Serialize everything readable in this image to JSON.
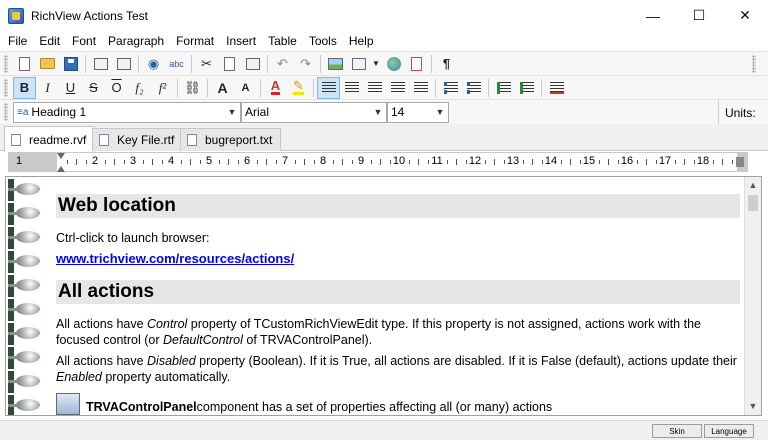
{
  "window": {
    "title": "RichView Actions Test",
    "minimize": "—",
    "maximize": "☐",
    "close": "✕"
  },
  "menu": [
    "File",
    "Edit",
    "Font",
    "Paragraph",
    "Format",
    "Insert",
    "Table",
    "Tools",
    "Help"
  ],
  "format_bar": {
    "style_value": "Heading 1",
    "font_value": "Arial",
    "size_value": "14",
    "units_label": "Units:"
  },
  "toolbar_glyphs": {
    "bold": "B",
    "italic": "I",
    "underline": "U",
    "strike": "S",
    "overline": "O",
    "subscript": "f₂",
    "superscript": "f²",
    "link": "⛓",
    "grow_font": "A",
    "shrink_font": "A",
    "font_color": "A",
    "pilcrow": "¶",
    "undo": "↶",
    "redo": "↷",
    "cut": "✂",
    "spell": "abc"
  },
  "tabs": [
    {
      "label": "readme.rvf",
      "active": true
    },
    {
      "label": "Key File.rtf",
      "active": false
    },
    {
      "label": "bugreport.txt",
      "active": false
    }
  ],
  "ruler": {
    "labels": [
      "1",
      "1",
      "2",
      "3",
      "4",
      "5",
      "6",
      "7",
      "8",
      "9",
      "10",
      "11",
      "12",
      "13",
      "14",
      "15",
      "16",
      "17",
      "18"
    ]
  },
  "document": {
    "heading1": "Web location",
    "line1": "Ctrl-click to launch browser:",
    "link": "www.trichview.com/resources/actions/",
    "heading2": "All actions",
    "para1": {
      "a": "All actions have ",
      "b": "Control",
      "c": " property of TCustomRichViewEdit type. If this property is not assigned, actions work with the focused control (or ",
      "d": "DefaultControl",
      "e": " of TRVAControlPanel)."
    },
    "para2": {
      "a": "All actions have ",
      "b": "Disabled",
      "c": " property (Boolean). If it is True, all actions are disabled. If it is False (default), actions update their ",
      "d": "Enabled",
      "e": " property automatically."
    },
    "para3": {
      "a": "TRVAControlPanel",
      "b": " component has a set of properties affecting all (or many) actions"
    }
  },
  "status": {
    "skin": "Skin",
    "language": "Language"
  },
  "colors": {
    "heading_bg": "#e6e6e6",
    "link": "#0000ee",
    "selection": "#cde4f7"
  }
}
